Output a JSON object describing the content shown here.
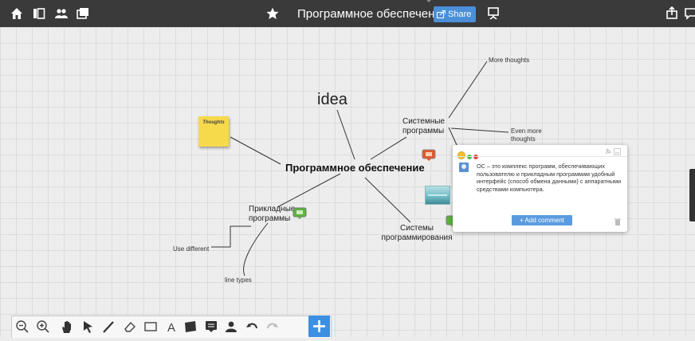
{
  "topbar": {
    "title": "Программное обеспечение",
    "share_label": "Share",
    "left_icons": [
      "home-icon",
      "panels-icon",
      "people-icon",
      "gallery-icon"
    ],
    "right_icons": [
      "presentation-icon",
      "upload-icon",
      "chat-icon"
    ]
  },
  "mindmap": {
    "central": "Программное обеспечение",
    "idea": "idea",
    "sticky_note": "Thoughts",
    "system_programs": [
      "Системные",
      "программы"
    ],
    "more_thoughts": "More thoughts",
    "even_more_thoughts": [
      "Even more",
      "thoughts"
    ],
    "applied_programs": [
      "Прикладные",
      "программы"
    ],
    "programming_systems": [
      "Системы",
      "программирования"
    ],
    "use_different": "Use different",
    "line_types": "line types"
  },
  "comment_popup": {
    "text": "ОС – это комплекс программ, обеспечивающих пользователю и прикладным программам удобный интерфейс (способ обмена данными) с аппаратными средствами компьютера.",
    "add_comment_label": "+ Add comment"
  },
  "toolbar": {
    "tools": [
      "zoom-out-icon",
      "zoom-in-icon",
      "hand-icon",
      "select-arrow-icon",
      "pen-icon",
      "eraser-icon",
      "rectangle-icon",
      "text-icon",
      "sticky-note-icon",
      "comment-icon",
      "user-icon",
      "undo-icon",
      "redo-icon",
      "add-icon"
    ]
  },
  "colors": {
    "topbar": "#3a3a3a",
    "accent": "#4a8fd8",
    "sticky": "#f7d94c"
  }
}
